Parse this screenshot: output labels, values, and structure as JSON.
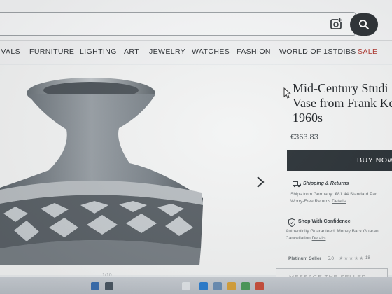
{
  "nav": {
    "items": [
      "IVALS",
      "FURNITURE",
      "LIGHTING",
      "ART",
      "JEWELRY",
      "WATCHES",
      "FASHION",
      "WORLD OF 1STDIBS",
      "SALE"
    ]
  },
  "product": {
    "title_lines": [
      "Mid-Century Studi",
      "Vase from Frank Ke",
      "1960s"
    ],
    "price": "€363.83",
    "buy_label": "BUY NOW",
    "image_index": "1/10"
  },
  "shipping": {
    "heading": "Shipping & Returns",
    "line1": "Ships from Germany: €81.44 Standard Par",
    "line2_text": "Worry-Free Returns",
    "line2_link": "Details"
  },
  "confidence": {
    "heading": "Shop With Confidence",
    "line1": "Authenticity Guaranteed, Money Back Guaran",
    "line2_text": "Cancellation",
    "line2_link": "Details"
  },
  "seller": {
    "label": "Platinum Seller",
    "score": "5.0",
    "stars": "★★★★★",
    "reviews": "18"
  },
  "message_button": "MESSAGE THE SELLER",
  "icons": {
    "camera": "camera-search-icon",
    "search": "search-icon",
    "next": "chevron-right-icon",
    "shipping": "truck-icon",
    "confidence": "shield-check-icon"
  },
  "colors": {
    "sale": "#b0372f",
    "buy_button": "#2b3237",
    "search_button": "#2f3438"
  }
}
